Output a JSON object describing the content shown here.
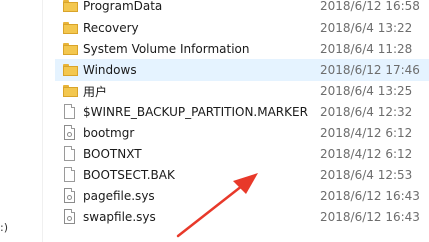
{
  "nav": {
    "partial_label": ":)"
  },
  "files": [
    {
      "name": "ProgramData",
      "date": "2018/6/12 16:58",
      "icon": "folder-icon"
    },
    {
      "name": "Recovery",
      "date": "2018/6/4 13:22",
      "icon": "folder-icon"
    },
    {
      "name": "System Volume Information",
      "date": "2018/6/4 11:28",
      "icon": "folder-icon"
    },
    {
      "name": "Windows",
      "date": "2018/6/12 17:46",
      "icon": "folder-icon",
      "selected": true
    },
    {
      "name": "用户",
      "date": "2018/6/4 13:25",
      "icon": "folder-icon"
    },
    {
      "name": "$WINRE_BACKUP_PARTITION.MARKER",
      "date": "2018/6/4 12:32",
      "icon": "file-icon"
    },
    {
      "name": "bootmgr",
      "date": "2018/4/12 6:12",
      "icon": "system-file-icon"
    },
    {
      "name": "BOOTNXT",
      "date": "2018/4/12 6:12",
      "icon": "file-icon"
    },
    {
      "name": "BOOTSECT.BAK",
      "date": "2018/6/4 12:53",
      "icon": "file-icon"
    },
    {
      "name": "pagefile.sys",
      "date": "2018/6/12 16:43",
      "icon": "system-file-icon"
    },
    {
      "name": "swapfile.sys",
      "date": "2018/6/12 16:43",
      "icon": "system-file-icon"
    }
  ],
  "colors": {
    "selection": "#e5f3ff",
    "annotation_arrow": "#e8392a",
    "folder": "#f3c74f"
  }
}
